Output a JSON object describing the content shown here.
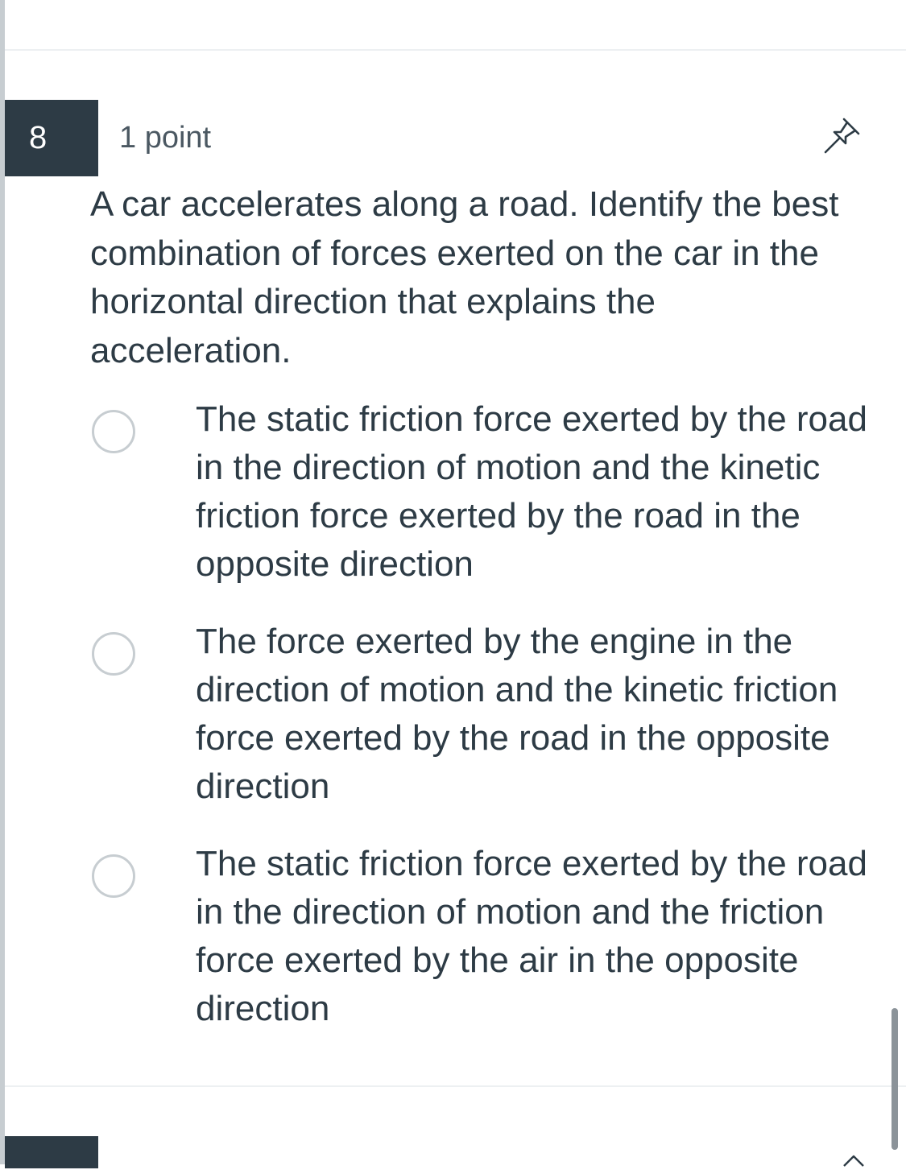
{
  "question": {
    "number": "8",
    "points": "1 point",
    "prompt": "A car accelerates along a road. Identify the best combination of forces exerted on the car in the horizontal direction that explains the acceleration.",
    "pin_icon": "pin-icon",
    "options": [
      {
        "label": "The static friction force exerted by the road in the direction of motion and the kinetic friction force exerted by the road in the opposite direction",
        "selected": false
      },
      {
        "label": "The force exerted by the engine in the direction of motion and the kinetic friction force exerted by the road in the opposite direction",
        "selected": false
      },
      {
        "label": "The static friction force exerted by the road in the direction of motion and the friction force exerted by the air in the opposite direction",
        "selected": false
      }
    ]
  },
  "colors": {
    "number_badge_bg": "#2d3b45",
    "text": "#2d3b45",
    "radio_border": "#c7cdd1"
  }
}
